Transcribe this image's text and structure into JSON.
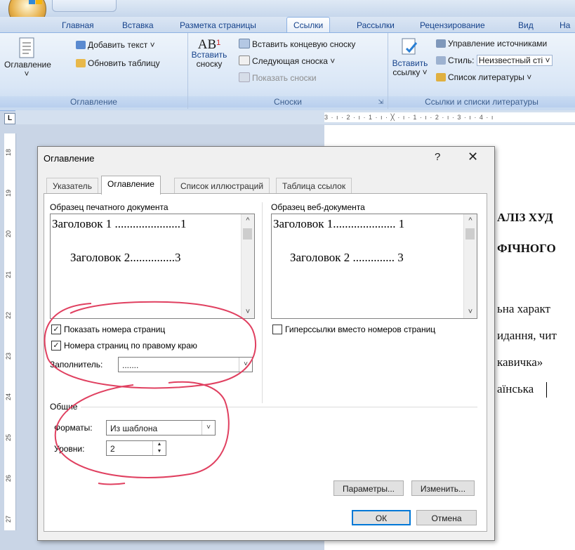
{
  "app": {
    "office_button": "office-logo"
  },
  "ribbon_tabs": [
    "Главная",
    "Вставка",
    "Разметка страницы",
    "Ссылки",
    "Рассылки",
    "Рецензирование",
    "Вид",
    "На"
  ],
  "active_tab": "Ссылки",
  "ribbon": {
    "toc_group": {
      "big_button": "Оглавление",
      "add_text": "Добавить текст ˅",
      "update_table": "Обновить таблицу",
      "label": "Оглавление"
    },
    "footnotes_group": {
      "insert_footnote_line1": "Вставить",
      "insert_footnote_line2": "сноску",
      "ab_glyph": "AB",
      "ab_sup": "1",
      "insert_endnote": "Вставить концевую сноску",
      "next_footnote": "Следующая сноска ˅",
      "show_notes": "Показать сноски",
      "label": "Сноски",
      "launcher": "⇲"
    },
    "citations_group": {
      "insert_citation_line1": "Вставить",
      "insert_citation_line2": "ссылку ˅",
      "manage_sources": "Управление источниками",
      "style_label": "Стиль:",
      "style_value": "Неизвестный сті ˅",
      "bibliography": "Список литературы ˅",
      "label": "Ссылки и списки литературы"
    }
  },
  "ruler": {
    "corner": "L",
    "h_text": "3 · ı · 2 · ı · 1 · ı · ╳ · ı · 1 · ı · 2 · ı · 3 · ı · 4 · ı",
    "v_numbers": [
      "18",
      "19",
      "20",
      "21",
      "22",
      "23",
      "24",
      "25",
      "26",
      "27"
    ]
  },
  "document": {
    "lines": [
      "АЛІЗ ХУД",
      "ФІЧНОГО",
      "ьна характ",
      "идання, чит",
      "кавичка»",
      "аїнська"
    ]
  },
  "dialog": {
    "title": "Оглавление",
    "help": "?",
    "close": "✕",
    "tabs": [
      "Указатель",
      "Оглавление",
      "Список иллюстраций",
      "Таблица ссылок"
    ],
    "active_tab": "Оглавление",
    "print_preview_label": "Образец печатного документа",
    "print_preview": {
      "line1": "Заголовок 1 ......................1",
      "line2": "Заголовок 2...............3"
    },
    "web_preview_label": "Образец веб-документа",
    "web_preview": {
      "line1": "Заголовок 1..................... 1",
      "line2": "Заголовок 2 .............. 3"
    },
    "show_page_numbers": {
      "label": "Показать номера страниц",
      "checked": true
    },
    "right_align": {
      "label": "Номера страниц по правому краю",
      "checked": true
    },
    "hyperlinks": {
      "label": "Гиперссылки вместо номеров страниц",
      "checked": false
    },
    "leader_label": "Заполнитель:",
    "leader_value": ".......",
    "general_label": "Общие",
    "formats_label": "Форматы:",
    "formats_value": "Из шаблона",
    "levels_label": "Уровни:",
    "levels_value": "2",
    "options_button": "Параметры...",
    "modify_button": "Изменить...",
    "ok_button": "ОК",
    "cancel_button": "Отмена"
  },
  "colors": {
    "annotation": "#e04060",
    "ribbon_text": "#15428b"
  }
}
